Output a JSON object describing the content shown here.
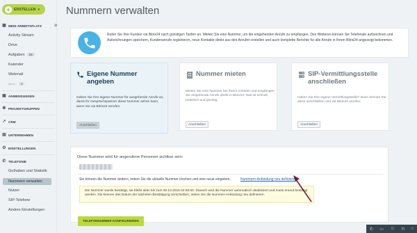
{
  "sidebar": {
    "create_label": "ERSTELLEN",
    "my_workplace": "MEIN ARBEITSPLATZ",
    "workplace_items": [
      {
        "label": "Activity Stream"
      },
      {
        "label": "Drive"
      },
      {
        "label": "Aufgaben",
        "badge": "15"
      },
      {
        "label": "Kalender"
      },
      {
        "label": "Webmail"
      }
    ],
    "more_label": "Mehr...",
    "more_badge": "1",
    "sections": [
      "ANWENDUNGEN",
      "PROJEKTGRUPPEN",
      "CRM",
      "UNTERNEHMEN",
      "EINSTELLUNGEN",
      "TELEFONIE"
    ],
    "telephony_items": [
      {
        "label": "Guthaben und Statistik"
      },
      {
        "label": "Nummern verwalten",
        "active": true
      },
      {
        "label": "Nutzer"
      },
      {
        "label": "SIP-Telefone"
      },
      {
        "label": "Andere Einstellungen"
      }
    ]
  },
  "page": {
    "title": "Nummern verwalten",
    "info_text": "Rufen Sie Ihre Kunden via Bitrix24 nach günstigen Tarifen an. Mieten Sie eine Nummer, um die eingehenden Anrufe zu empfangen. Des Weiteren können Sie Telefonate aufzeichnen und Aufzeichnungen speichern, Kundenanrufe registrieren, neue Kontakte direkt aus den Anrufen erstellen und auch komplette Berichte für alle Anrufe in Ihrem Bitrix24 angezeigt bekommen."
  },
  "cards": [
    {
      "title_line1": "Eigene Nummer",
      "title_line2": "angeben",
      "desc": "Geben Sie Ihre eigene Nummer für ausgehende Anrufe an, damit Ihr Gesprächspartner diese Nummer sehen kann, wenn Sie via Bitrix24 anrufen.",
      "button": "Anschließen"
    },
    {
      "title_line1": "Nummer mieten",
      "title_line2": "",
      "desc": "Mieten Sie eine Nummer bei Ihrem Anbieter und empfangen Sie eingehende Anrufe direkt in Bitrix24. Das ist schnell, praktisch und günstig.",
      "button": "Anschließen"
    },
    {
      "title_line1": "SIP-Vermittlungsstelle",
      "title_line2": "anschließen",
      "desc": "Haben Sie Ihre eigene Vermittlungsstelle? Dann können Sie diese anschließen und via Bitrix24 anrufen.",
      "button": "Anschließen"
    }
  ],
  "form": {
    "label": "Diese Nummer wird für angerufene Personen sichtbar sein:",
    "change_text": "Sie können die Nummer ändern, indem Sie die aktuelle Nummer löschen und eine neue eingeben.",
    "change_link": "Nummern-Anbindung neu definieren",
    "notice": "Die Nummer wurde bestätigt, sie bleibt aktiv bis zum 09.10.2015 02:00:00. Danach wird die Nummer automatisch deaktiviert und muss erneut bestätigt werden. Sie können das Datum der nächsten Bestätigung verschieben, indem Sie die Nummer-Anbindung neu definieren.",
    "configure_button": "TELEFONNUMMER KONFIGURIEREN"
  },
  "colors": {
    "accent_green": "#bbd840",
    "phone_blue": "#4ab3e5",
    "arrow": "#7a1a2e",
    "link": "#2067b0"
  }
}
